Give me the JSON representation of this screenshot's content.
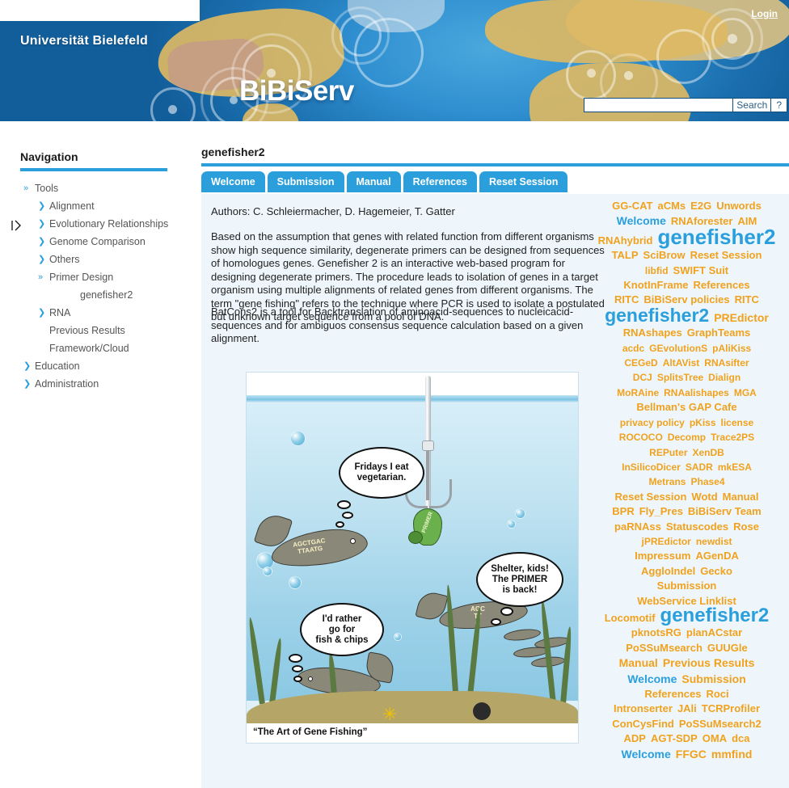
{
  "header": {
    "university": "Universität Bielefeld",
    "site_logo": "BiBiServ",
    "login_label": "Login",
    "search_value": "",
    "search_placeholder": "",
    "search_button": "Search",
    "help_button": "?",
    "colors": {
      "banner_blue": "#1d6fae",
      "land": "#dcb863"
    }
  },
  "sidebar": {
    "title": "Navigation",
    "accent": "#2a9fdc",
    "items": [
      {
        "label": "Tools",
        "level": 0,
        "bullet": "double-chevron"
      },
      {
        "label": "Alignment",
        "level": 1,
        "bullet": "chevron"
      },
      {
        "label": "Evolutionary Relationships",
        "level": 1,
        "bullet": "chevron"
      },
      {
        "label": "Genome Comparison",
        "level": 1,
        "bullet": "chevron"
      },
      {
        "label": "Others",
        "level": 1,
        "bullet": "chevron"
      },
      {
        "label": "Primer Design",
        "level": 1,
        "bullet": "double-chevron"
      },
      {
        "label": "genefisher2",
        "level": 2,
        "bullet": "none"
      },
      {
        "label": "RNA",
        "level": 1,
        "bullet": "chevron"
      },
      {
        "label": "Previous Results",
        "level": 1,
        "bullet": "none"
      },
      {
        "label": "Framework/Cloud",
        "level": 1,
        "bullet": "none"
      },
      {
        "label": "Education",
        "level": 0,
        "bullet": "chevron"
      },
      {
        "label": "Administration",
        "level": 0,
        "bullet": "chevron"
      }
    ]
  },
  "main": {
    "page_title": "genefisher2",
    "tabs": [
      {
        "label": "Welcome",
        "active": true
      },
      {
        "label": "Submission",
        "active": false
      },
      {
        "label": "Manual",
        "active": false
      },
      {
        "label": "References",
        "active": false
      },
      {
        "label": "Reset Session",
        "active": false
      }
    ],
    "authors": "Authors: C. Schleiermacher, D. Hagemeier, T. Gatter",
    "paragraph_1": "Based on the assumption that genes with related function from different organisms show high sequence similarity, degenerate primers can be designed from sequences of homologues genes. Genefisher 2 is an interactive web-based program for designing degenerate primers. The procedure leads to isolation of genes in a target organism using multiple alignments of related genes from different organisms. The term \"gene fishing\" refers to the technique where PCR is used to isolate a postulated but unknown target sequence from a pool of DNA.",
    "paragraph_2": "BatCons2 is a tool for Backtranslation of aminoacid-sequences to nucleicacid-sequences and for ambiguos consensus sequence calculation based on a given alignment."
  },
  "cartoon": {
    "caption": "“The Art of Gene Fishing”",
    "bubble_1": "Fridays I eat\nvegetarian.",
    "bubble_2": "Shelter, kids!\nThe PRIMER\nis back!",
    "bubble_3": "I'd rather\ngo for\nfish & chips",
    "fish_label_1": "AGCTGAC\nTTAATG",
    "fish_label_2": "AGC\nTT\nG",
    "worm_label": "PRIMER"
  },
  "footer": {
    "expander_icon": "panel-expand-icon"
  },
  "tagcloud": {
    "colors": {
      "orange": "#f0a21e",
      "orange_light": "#f5b942",
      "blue": "#2a9fdc",
      "blue_light": "#4fb0e2"
    },
    "tags": [
      {
        "t": "GG-CAT",
        "s": 13,
        "c": "o"
      },
      {
        "t": "aCMs",
        "s": 13,
        "c": "o"
      },
      {
        "t": "E2G",
        "s": 13,
        "c": "o"
      },
      {
        "t": "Unwords",
        "s": 13,
        "c": "o"
      },
      {
        "t": "BR",
        "s": 0,
        "c": "br"
      },
      {
        "t": "Welcome",
        "s": 14,
        "c": "b"
      },
      {
        "t": "RNAforester",
        "s": 13,
        "c": "o"
      },
      {
        "t": "AIM",
        "s": 13,
        "c": "o"
      },
      {
        "t": "BR",
        "s": 0,
        "c": "br"
      },
      {
        "t": "RNAhybrid",
        "s": 13,
        "c": "o"
      },
      {
        "t": "genefisher2",
        "s": 26,
        "c": "b"
      },
      {
        "t": "BR",
        "s": 0,
        "c": "br"
      },
      {
        "t": "TALP",
        "s": 13,
        "c": "o"
      },
      {
        "t": "SciBrow",
        "s": 13,
        "c": "o"
      },
      {
        "t": "Reset Session",
        "s": 13,
        "c": "o"
      },
      {
        "t": "BR",
        "s": 0,
        "c": "br"
      },
      {
        "t": "libfid",
        "s": 12,
        "c": "o"
      },
      {
        "t": "SWIFT Suit",
        "s": 13,
        "c": "o"
      },
      {
        "t": "BR",
        "s": 0,
        "c": "br"
      },
      {
        "t": "KnotInFrame",
        "s": 13,
        "c": "o"
      },
      {
        "t": "References",
        "s": 13,
        "c": "o"
      },
      {
        "t": "BR",
        "s": 0,
        "c": "br"
      },
      {
        "t": "RITC",
        "s": 13,
        "c": "o"
      },
      {
        "t": "BiBiServ policies",
        "s": 13,
        "c": "o"
      },
      {
        "t": "RITC",
        "s": 13,
        "c": "o"
      },
      {
        "t": "BR",
        "s": 0,
        "c": "br"
      },
      {
        "t": "genefisher2",
        "s": 23,
        "c": "b"
      },
      {
        "t": "PREdictor",
        "s": 14,
        "c": "o"
      },
      {
        "t": "BR",
        "s": 0,
        "c": "br"
      },
      {
        "t": "RNAshapes",
        "s": 13,
        "c": "o"
      },
      {
        "t": "GraphTeams",
        "s": 13,
        "c": "o"
      },
      {
        "t": "BR",
        "s": 0,
        "c": "br"
      },
      {
        "t": "acdc",
        "s": 12,
        "c": "o"
      },
      {
        "t": "GEvolutionS",
        "s": 12,
        "c": "o"
      },
      {
        "t": "pAliKiss",
        "s": 12,
        "c": "o"
      },
      {
        "t": "BR",
        "s": 0,
        "c": "br"
      },
      {
        "t": "CEGeD",
        "s": 12,
        "c": "o"
      },
      {
        "t": "AltAVist",
        "s": 12,
        "c": "o"
      },
      {
        "t": "RNAsifter",
        "s": 12,
        "c": "o"
      },
      {
        "t": "BR",
        "s": 0,
        "c": "br"
      },
      {
        "t": "DCJ",
        "s": 12,
        "c": "o"
      },
      {
        "t": "SplitsTree",
        "s": 12,
        "c": "o"
      },
      {
        "t": "Dialign",
        "s": 12,
        "c": "o"
      },
      {
        "t": "BR",
        "s": 0,
        "c": "br"
      },
      {
        "t": "MoRAine",
        "s": 12,
        "c": "o"
      },
      {
        "t": "RNAalishapes",
        "s": 12,
        "c": "o"
      },
      {
        "t": "MGA",
        "s": 12,
        "c": "o"
      },
      {
        "t": "BR",
        "s": 0,
        "c": "br"
      },
      {
        "t": "Bellman's GAP Cafe",
        "s": 13,
        "c": "o"
      },
      {
        "t": "BR",
        "s": 0,
        "c": "br"
      },
      {
        "t": "privacy policy",
        "s": 12,
        "c": "o"
      },
      {
        "t": "pKiss",
        "s": 12,
        "c": "o"
      },
      {
        "t": "license",
        "s": 12,
        "c": "o"
      },
      {
        "t": "BR",
        "s": 0,
        "c": "br"
      },
      {
        "t": "ROCOCO",
        "s": 12,
        "c": "o"
      },
      {
        "t": "Decomp",
        "s": 12,
        "c": "o"
      },
      {
        "t": "Trace2PS",
        "s": 12,
        "c": "o"
      },
      {
        "t": "BR",
        "s": 0,
        "c": "br"
      },
      {
        "t": "REPuter",
        "s": 12,
        "c": "o"
      },
      {
        "t": "XenDB",
        "s": 12,
        "c": "o"
      },
      {
        "t": "BR",
        "s": 0,
        "c": "br"
      },
      {
        "t": "InSilicoDicer",
        "s": 12,
        "c": "o"
      },
      {
        "t": "SADR",
        "s": 12,
        "c": "o"
      },
      {
        "t": "mkESA",
        "s": 12,
        "c": "o"
      },
      {
        "t": "BR",
        "s": 0,
        "c": "br"
      },
      {
        "t": "Metrans",
        "s": 12,
        "c": "o"
      },
      {
        "t": "Phase4",
        "s": 12,
        "c": "o"
      },
      {
        "t": "BR",
        "s": 0,
        "c": "br"
      },
      {
        "t": "Reset Session",
        "s": 13,
        "c": "o"
      },
      {
        "t": "Wotd",
        "s": 13,
        "c": "o"
      },
      {
        "t": "Manual",
        "s": 13,
        "c": "o"
      },
      {
        "t": "BR",
        "s": 0,
        "c": "br"
      },
      {
        "t": "BPR",
        "s": 13,
        "c": "o"
      },
      {
        "t": "Fly_Pres",
        "s": 13,
        "c": "o"
      },
      {
        "t": "BiBiServ Team",
        "s": 13,
        "c": "o"
      },
      {
        "t": "BR",
        "s": 0,
        "c": "br"
      },
      {
        "t": "paRNAss",
        "s": 13,
        "c": "o"
      },
      {
        "t": "Statuscodes",
        "s": 13,
        "c": "o"
      },
      {
        "t": "Rose",
        "s": 13,
        "c": "o"
      },
      {
        "t": "BR",
        "s": 0,
        "c": "br"
      },
      {
        "t": "jPREdictor",
        "s": 12,
        "c": "o"
      },
      {
        "t": "newdist",
        "s": 12,
        "c": "o"
      },
      {
        "t": "BR",
        "s": 0,
        "c": "br"
      },
      {
        "t": "Impressum",
        "s": 13,
        "c": "o"
      },
      {
        "t": "AGenDA",
        "s": 13,
        "c": "o"
      },
      {
        "t": "BR",
        "s": 0,
        "c": "br"
      },
      {
        "t": "AggloIndel",
        "s": 13,
        "c": "o"
      },
      {
        "t": "Gecko",
        "s": 13,
        "c": "o"
      },
      {
        "t": "BR",
        "s": 0,
        "c": "br"
      },
      {
        "t": "Submission",
        "s": 13,
        "c": "o"
      },
      {
        "t": "BR",
        "s": 0,
        "c": "br"
      },
      {
        "t": "WebService Linklist",
        "s": 13,
        "c": "o"
      },
      {
        "t": "BR",
        "s": 0,
        "c": "br"
      },
      {
        "t": "Locomotif",
        "s": 13,
        "c": "o"
      },
      {
        "t": "genefisher2",
        "s": 24,
        "c": "b"
      },
      {
        "t": "BR",
        "s": 0,
        "c": "br"
      },
      {
        "t": "pknotsRG",
        "s": 13,
        "c": "o"
      },
      {
        "t": "planACstar",
        "s": 13,
        "c": "o"
      },
      {
        "t": "BR",
        "s": 0,
        "c": "br"
      },
      {
        "t": "PoSSuMsearch",
        "s": 13,
        "c": "o"
      },
      {
        "t": "GUUGle",
        "s": 13,
        "c": "o"
      },
      {
        "t": "BR",
        "s": 0,
        "c": "br"
      },
      {
        "t": "Manual",
        "s": 14,
        "c": "o"
      },
      {
        "t": "Previous Results",
        "s": 14,
        "c": "o"
      },
      {
        "t": "BR",
        "s": 0,
        "c": "br"
      },
      {
        "t": "Welcome",
        "s": 14,
        "c": "b"
      },
      {
        "t": "Submission",
        "s": 14,
        "c": "o"
      },
      {
        "t": "BR",
        "s": 0,
        "c": "br"
      },
      {
        "t": "References",
        "s": 13,
        "c": "o"
      },
      {
        "t": "Roci",
        "s": 13,
        "c": "o"
      },
      {
        "t": "BR",
        "s": 0,
        "c": "br"
      },
      {
        "t": "Intronserter",
        "s": 13,
        "c": "o"
      },
      {
        "t": "JAli",
        "s": 13,
        "c": "o"
      },
      {
        "t": "TCRProfiler",
        "s": 13,
        "c": "o"
      },
      {
        "t": "BR",
        "s": 0,
        "c": "br"
      },
      {
        "t": "ConCysFind",
        "s": 13,
        "c": "o"
      },
      {
        "t": "PoSSuMsearch2",
        "s": 13,
        "c": "o"
      },
      {
        "t": "BR",
        "s": 0,
        "c": "br"
      },
      {
        "t": "ADP",
        "s": 13,
        "c": "o"
      },
      {
        "t": "AGT-SDP",
        "s": 13,
        "c": "o"
      },
      {
        "t": "OMA",
        "s": 13,
        "c": "o"
      },
      {
        "t": "dca",
        "s": 13,
        "c": "o"
      },
      {
        "t": "BR",
        "s": 0,
        "c": "br"
      },
      {
        "t": "Welcome",
        "s": 14,
        "c": "b"
      },
      {
        "t": "FFGC",
        "s": 14,
        "c": "o"
      },
      {
        "t": "mmfind",
        "s": 14,
        "c": "o"
      }
    ]
  }
}
